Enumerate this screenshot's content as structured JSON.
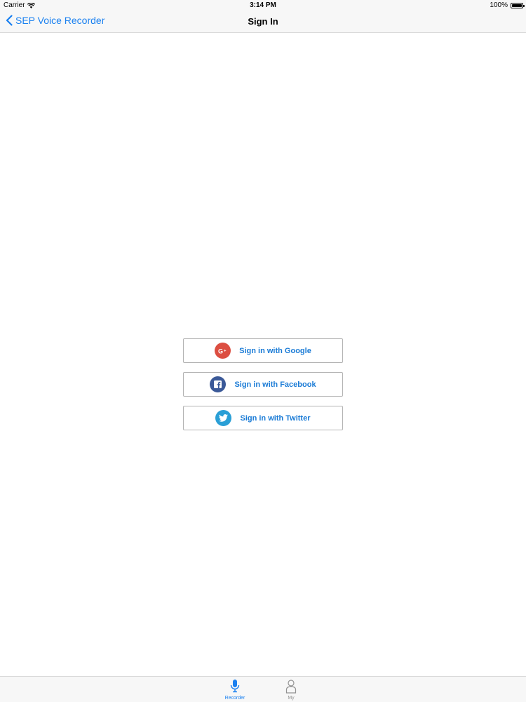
{
  "status_bar": {
    "carrier": "Carrier",
    "time": "3:14 PM",
    "battery_percent": "100%",
    "icons": [
      "wifi-icon",
      "battery-icon"
    ]
  },
  "nav_bar": {
    "back_label": "SEP Voice Recorder",
    "title": "Sign In",
    "accent_color": "#1a80f0"
  },
  "signin": {
    "buttons": [
      {
        "label": "Sign in with Google",
        "icon": "google-plus-icon",
        "icon_glyph": "G+",
        "color": "#dc4e41"
      },
      {
        "label": "Sign in with Facebook",
        "icon": "facebook-icon",
        "icon_glyph": "f",
        "color": "#3b5998"
      },
      {
        "label": "Sign in with Twitter",
        "icon": "twitter-icon",
        "icon_glyph": "",
        "color": "#2a9fd6"
      }
    ]
  },
  "tab_bar": {
    "tabs": [
      {
        "label": "Recorder",
        "icon": "microphone-icon",
        "selected": true
      },
      {
        "label": "My",
        "icon": "person-icon",
        "selected": false
      }
    ]
  }
}
